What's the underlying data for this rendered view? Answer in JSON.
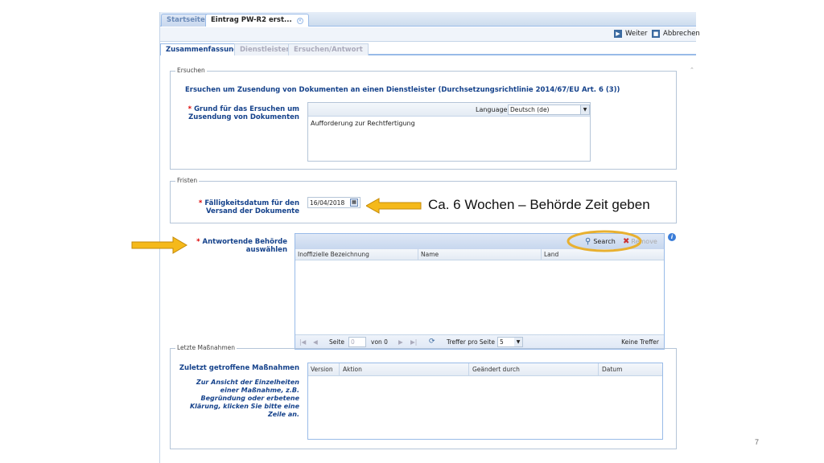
{
  "tabs": {
    "home": "Startseite",
    "entry": "Eintrag PW-R2 erst..."
  },
  "toolbar": {
    "next": "Weiter",
    "cancel": "Abbrechen"
  },
  "subtabs": [
    "Zusammenfassung",
    "Dienstleister",
    "Ersuchen/Antwort"
  ],
  "request": {
    "legend": "Ersuchen",
    "title": "Ersuchen um Zusendung von Dokumenten an einen Dienstleister (Durchsetzungsrichtlinie 2014/67/EU Art. 6 (3))",
    "reason_label_line1": "Grund für das Ersuchen um",
    "reason_label_line2": "Zusendung von Dokumenten",
    "language_label": "Language",
    "language_value": "Deutsch (de)",
    "reason_text": "Aufforderung zur Rechtfertigung"
  },
  "deadlines": {
    "legend": "Fristen",
    "due_label_line1": "Fälligkeitsdatum für den",
    "due_label_line2": "Versand der Dokumente",
    "due_value": "16/04/2018"
  },
  "annotation": {
    "text": "Ca. 6 Wochen – Behörde Zeit geben"
  },
  "authority": {
    "label_line1": "Antwortende Behörde",
    "label_line2": "auswählen",
    "search": "Search",
    "remove": "Remove",
    "columns": [
      "Inoffizielle Bezeichnung",
      "Name",
      "Land"
    ],
    "page_label": "Seite",
    "page_value": "0",
    "of_label": "von 0",
    "per_page_label": "Treffer pro Seite",
    "per_page_value": "5",
    "no_results": "Keine Treffer"
  },
  "measures": {
    "legend": "Letzte Maßnahmen",
    "label": "Zuletzt getroffene Maßnahmen",
    "note": "Zur Ansicht der Einzelheiten einer Maßnahme, z.B. Begründung oder erbetene Klärung, klicken Sie bitte eine Zeile an.",
    "columns": [
      "Version",
      "Aktion",
      "Geändert durch",
      "Datum"
    ]
  },
  "slide_number": "7",
  "colors": {
    "accent": "#15428b",
    "arrow": "#f5b91a",
    "highlight_ring": "#e8b030"
  }
}
